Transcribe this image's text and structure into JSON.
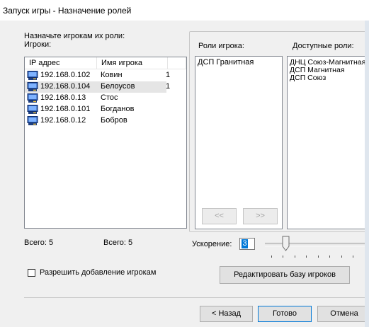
{
  "window": {
    "title": "Запуск игры - Назначение ролей"
  },
  "players_section": {
    "assign_label": "Назначьте игрокам их роли:",
    "players_label": "Игроки:",
    "columns": {
      "ip": "IP адрес",
      "name": "Имя игрока"
    },
    "rows": [
      {
        "ip": "192.168.0.102",
        "name": "Ковин",
        "count": "1"
      },
      {
        "ip": "192.168.0.104",
        "name": "Белоусов",
        "count": "1"
      },
      {
        "ip": "192.168.0.13",
        "name": "Стос",
        "count": ""
      },
      {
        "ip": "192.168.0.101",
        "name": "Богданов",
        "count": ""
      },
      {
        "ip": "192.168.0.12",
        "name": "Бобров",
        "count": ""
      }
    ],
    "total_left": "Всего: 5",
    "total_right": "Всего: 5"
  },
  "roles_section": {
    "player_roles_label": "Роли игрока:",
    "available_roles_label": "Доступные роли:",
    "player_roles": [
      "ДСП Гранитная"
    ],
    "available_roles": [
      "ДНЦ Союз-Магнитная",
      "ДСП Магнитная",
      "ДСП Союз"
    ],
    "move_left": "<<",
    "move_right": ">>"
  },
  "speed": {
    "label": "Ускорение:",
    "value": "3"
  },
  "allow_add_players": {
    "label": "Разрешить добавление игрокам",
    "checked": false
  },
  "edit_db_button": "Редактировать базу игроков",
  "footer": {
    "back": "< Назад",
    "done": "Готово",
    "cancel": "Отмена"
  }
}
